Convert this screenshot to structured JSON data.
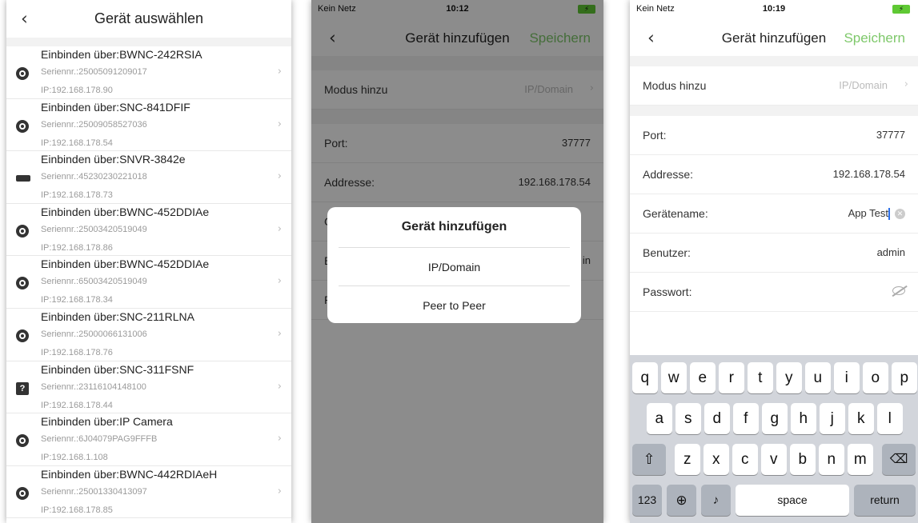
{
  "screen1": {
    "title": "Gerät auswählen",
    "devices": [
      {
        "name": "Einbinden über:BWNC-242RSIA",
        "serial": "Seriennr.:25005091209017",
        "ip": "IP:192.168.178.90",
        "icon": "camera-icon"
      },
      {
        "name": "Einbinden über:SNC-841DFIF",
        "serial": "Seriennr.:25009058527036",
        "ip": "IP:192.168.178.54",
        "icon": "camera-icon"
      },
      {
        "name": "Einbinden über:SNVR-3842e",
        "serial": "Seriennr.:45230230221018",
        "ip": "IP:192.168.178.73",
        "icon": "nvr-icon"
      },
      {
        "name": "Einbinden über:BWNC-452DDIAe",
        "serial": "Seriennr.:25003420519049",
        "ip": "IP:192.168.178.86",
        "icon": "camera-icon"
      },
      {
        "name": "Einbinden über:BWNC-452DDIAe",
        "serial": "Seriennr.:65003420519049",
        "ip": "IP:192.168.178.34",
        "icon": "camera-icon"
      },
      {
        "name": "Einbinden über:SNC-211RLNA",
        "serial": "Seriennr.:25000066131006",
        "ip": "IP:192.168.178.76",
        "icon": "camera-icon"
      },
      {
        "name": "Einbinden über:SNC-311FSNF",
        "serial": "Seriennr.:23116104148100",
        "ip": "IP:192.168.178.44",
        "icon": "unknown-device-icon"
      },
      {
        "name": "Einbinden über:IP Camera",
        "serial": "Seriennr.:6J04079PAG9FFFB",
        "ip": "IP:192.168.1.108",
        "icon": "camera-icon"
      },
      {
        "name": "Einbinden über:BWNC-442RDIAeH",
        "serial": "Seriennr.:25001330413097",
        "ip": "IP:192.168.178.85",
        "icon": "camera-icon"
      }
    ]
  },
  "screen2": {
    "status": {
      "carrier": "Kein Netz",
      "time": "10:12"
    },
    "title": "Gerät hinzufügen",
    "save": "Speichern",
    "mode_label": "Modus hinzu",
    "mode_value": "IP/Domain",
    "port_label": "Port:",
    "port_value": "37777",
    "address_label": "Addresse:",
    "address_value": "192.168.178.54",
    "partial_row_c": "G",
    "partial_row_b": "B",
    "partial_row_b_val": "in",
    "partial_row_p": "P",
    "dialog": {
      "title": "Gerät hinzufügen",
      "options": [
        "IP/Domain",
        "Peer to Peer"
      ]
    }
  },
  "screen3": {
    "status": {
      "carrier": "Kein Netz",
      "time": "10:19"
    },
    "title": "Gerät hinzufügen",
    "save": "Speichern",
    "mode_label": "Modus hinzu",
    "mode_value": "IP/Domain",
    "port_label": "Port:",
    "port_value": "37777",
    "address_label": "Addresse:",
    "address_value": "192.168.178.54",
    "name_label": "Gerätename:",
    "name_value": "App Test",
    "user_label": "Benutzer:",
    "user_value": "admin",
    "password_label": "Passwort:",
    "keyboard": {
      "row1": [
        "q",
        "w",
        "e",
        "r",
        "t",
        "y",
        "u",
        "i",
        "o",
        "p"
      ],
      "row2": [
        "a",
        "s",
        "d",
        "f",
        "g",
        "h",
        "j",
        "k",
        "l"
      ],
      "row3": [
        "z",
        "x",
        "c",
        "v",
        "b",
        "n",
        "m"
      ],
      "num_key": "123",
      "space": "space",
      "return": "return"
    }
  },
  "colors": {
    "accent_green": "#7ec86a",
    "battery_green": "#5fc934"
  }
}
